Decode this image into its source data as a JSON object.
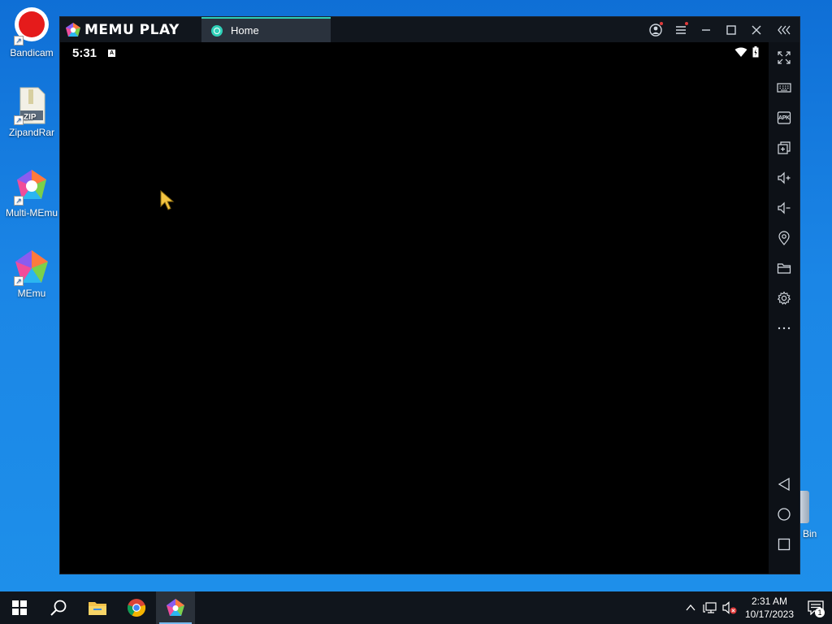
{
  "desktop": {
    "icons": [
      {
        "label": "Bandicam"
      },
      {
        "label": "ZipandRar"
      },
      {
        "label": "Multi-MEmu"
      },
      {
        "label": "MEmu"
      }
    ],
    "recycle_bin_partial_label": "Bin",
    "zip_badge": "ZIP"
  },
  "emulator": {
    "brand": "MEMU PLAY",
    "tab": {
      "label": "Home"
    },
    "accent_color": "#2fd0b8",
    "android": {
      "time": "5:31",
      "status_badge": "A"
    },
    "sidebar_apk_label": "APK"
  },
  "taskbar": {
    "clock_time": "2:31 AM",
    "clock_date": "10/17/2023",
    "notification_count": "1"
  }
}
